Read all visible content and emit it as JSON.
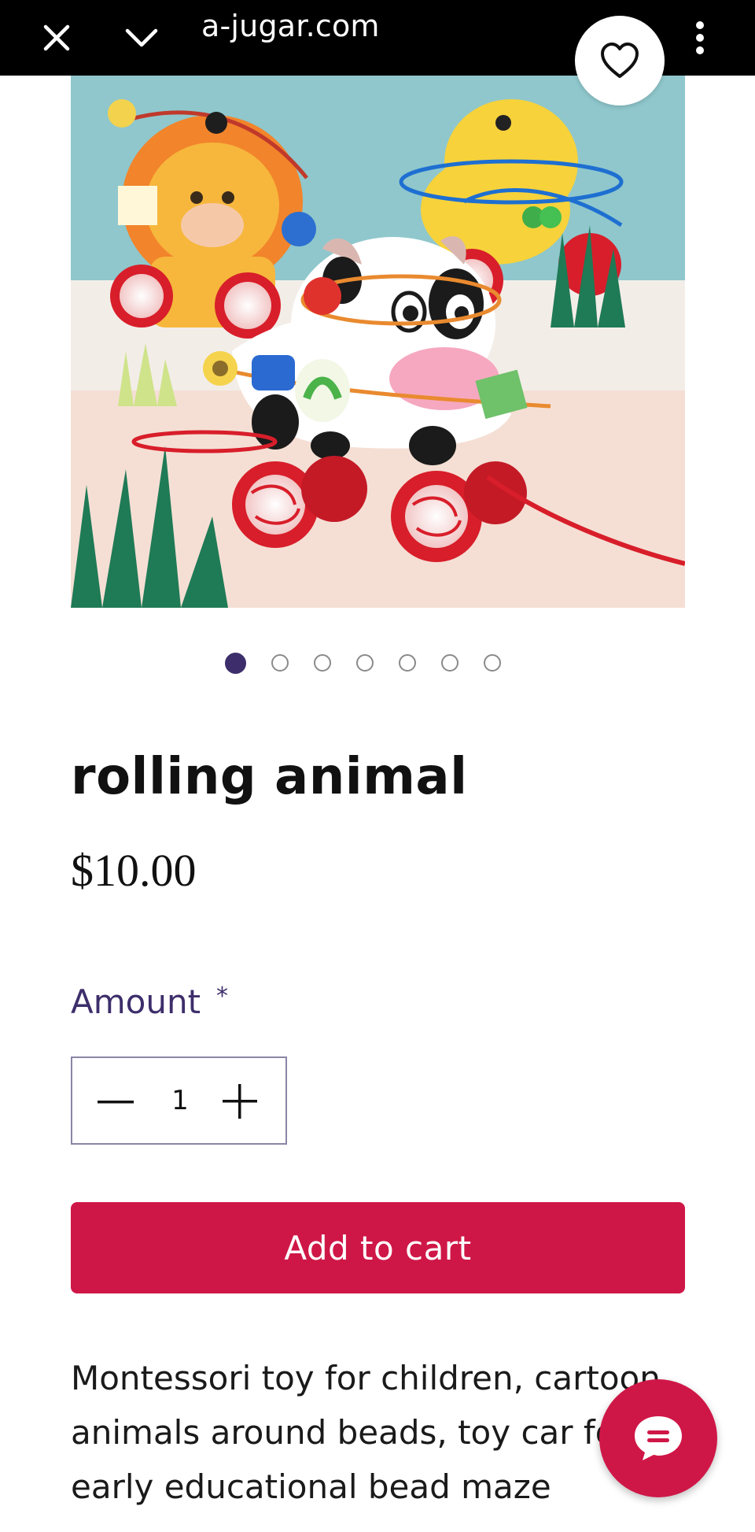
{
  "browser": {
    "url": "a-jugar.com",
    "icons": [
      "close-icon",
      "chevron-down-icon",
      "share-icon",
      "more-vertical-icon"
    ]
  },
  "product": {
    "image_alt": "rolling animal",
    "image_count": 7,
    "active_image": 1,
    "title": "rolling animal",
    "price": "$10.00",
    "amount_label": "Amount",
    "required_marker": "*",
    "quantity": "1",
    "add_to_cart_label": "Add to cart",
    "description": "Montessori toy for children, cartoon animals around beads, toy car for kids, early educational bead maze"
  },
  "colors": {
    "accent": "#cf1747",
    "label": "#3d2e6b",
    "topbar": "#000000"
  }
}
